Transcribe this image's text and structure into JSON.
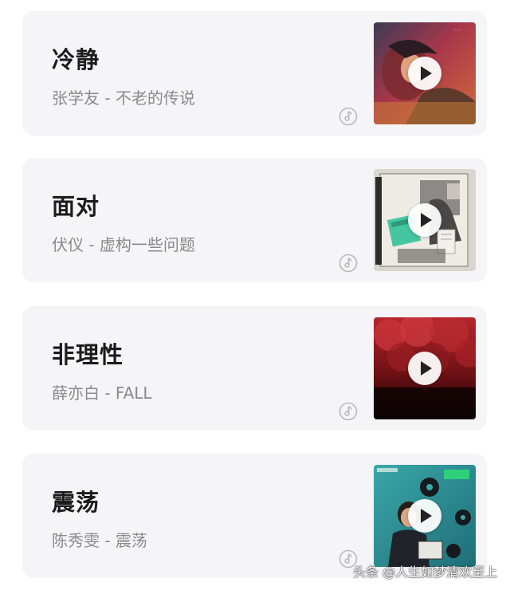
{
  "songs": [
    {
      "title": "冷静",
      "subtitle": "张学友 - 不老的传说",
      "cover": "cover-1"
    },
    {
      "title": "面对",
      "subtitle": "伏仪 - 虚构一些问题",
      "cover": "cover-2"
    },
    {
      "title": "非理性",
      "subtitle": "薛亦白 - FALL",
      "cover": "cover-3"
    },
    {
      "title": "震荡",
      "subtitle": "陈秀雯 - 震荡",
      "cover": "cover-4"
    }
  ],
  "icons": {
    "play": "play-icon",
    "music_source": "music-note-icon"
  },
  "colors": {
    "card_background": "#f5f5f7",
    "title": "#1c1c1c",
    "subtitle": "#8a8a8a"
  },
  "watermark": "头条 @人生如梦清欢至上"
}
